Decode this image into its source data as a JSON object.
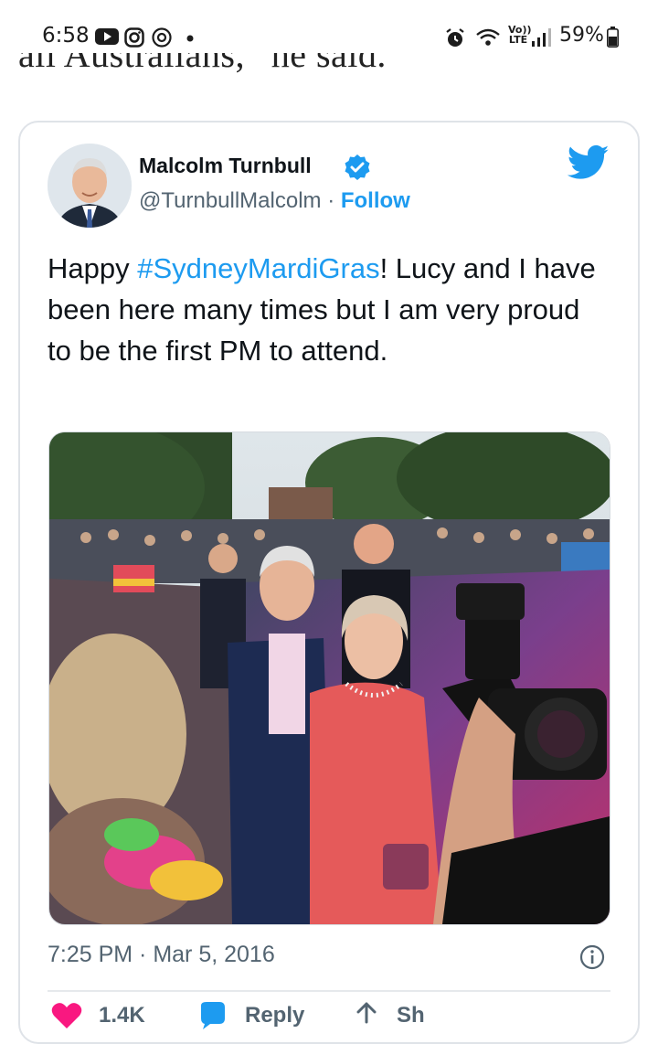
{
  "status_bar": {
    "time": "6:58",
    "battery_percent": "59%",
    "network_label": "Vo)) LTE",
    "icons": [
      "youtube-icon",
      "instagram-icon",
      "threads-icon",
      "dot-icon",
      "alarm-icon",
      "wifi-icon",
      "signal-icon",
      "battery-icon"
    ]
  },
  "article": {
    "clipped_text": "all Australians,” he said."
  },
  "tweet": {
    "author_name": "Malcolm Turnbull",
    "handle": "@TurnbullMalcolm",
    "separator": " · ",
    "follow_label": "Follow",
    "text_before": "Happy ",
    "hashtag": "#SydneyMardiGras",
    "text_after": "! Lucy and I have been here many times but I am very proud to be the first PM to attend.",
    "timestamp": "7:25 PM · Mar 5, 2016",
    "actions": {
      "like_count": "1.4K",
      "reply_label": "Reply",
      "share_label": "Sh"
    }
  },
  "colors": {
    "twitter_blue": "#1d9bf0",
    "text_primary": "#0f1419",
    "text_secondary": "#536471",
    "like_red": "#f91880"
  }
}
